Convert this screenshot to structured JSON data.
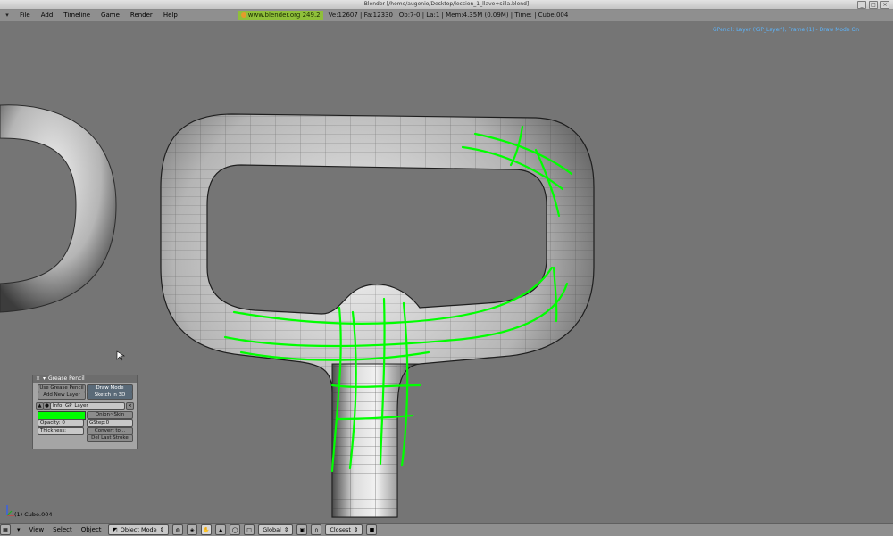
{
  "window": {
    "title": "Blender [/home/augenio/Desktop/leccion_1_llave+silla.blend]"
  },
  "menu": {
    "items": [
      "File",
      "Add",
      "Timeline",
      "Game",
      "Render",
      "Help"
    ],
    "badge": "www.blender.org 249.2",
    "stats": "Ve:12607 | Fa:12330 | Ob:7-0 | La:1  | Mem:4.35M (0.09M)  | Time: | Cube.004"
  },
  "viewport": {
    "gp_status": "GPencil: Layer ('GP_Layer'), Frame (1) - Draw Mode On",
    "object_label": "(1) Cube.004",
    "stroke_color": "#00ff00",
    "background": "#757575"
  },
  "gp_panel": {
    "title": "Grease Pencil",
    "use_grease_pencil": "Use Grease Pencil",
    "draw_mode": "Draw Mode",
    "add_new_layer": "Add New Layer",
    "sketch_in_3d": "Sketch in 3D",
    "layer_info": "Info: GP_Layer",
    "opacity": "Opacity: 0",
    "onion_skin": "Onion~Skin",
    "gstep": "GStep:0",
    "thickness": "Thickness:",
    "convert_to": "Convert to...",
    "del_last_stroke": "Del Last Stroke",
    "swatch_color": "#00ff00"
  },
  "bottom": {
    "menus": [
      "View",
      "Select",
      "Object"
    ],
    "mode": "Object Mode",
    "orientation": "Global",
    "snap": "Closest"
  }
}
